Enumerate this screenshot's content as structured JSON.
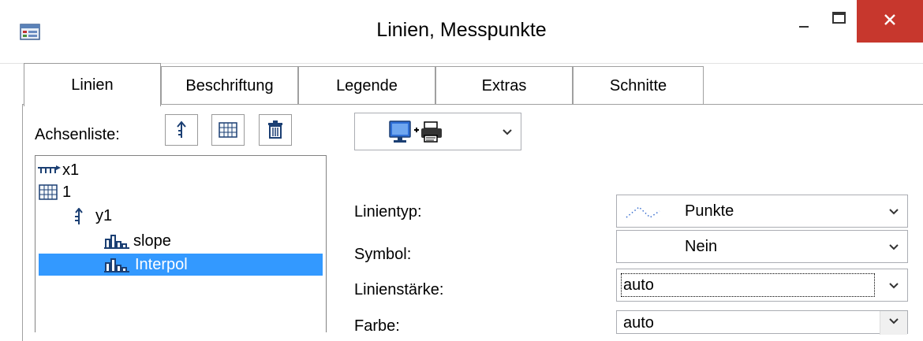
{
  "window": {
    "title": "Linien, Messpunkte",
    "close_symbol": "✕"
  },
  "tabs": [
    {
      "label": "Linien",
      "active": true
    },
    {
      "label": "Beschriftung",
      "active": false
    },
    {
      "label": "Legende",
      "active": false
    },
    {
      "label": "Extras",
      "active": false
    },
    {
      "label": "Schnitte",
      "active": false
    }
  ],
  "axis_list": {
    "label": "Achsenliste:",
    "toolbar": [
      "axis-arrow-icon",
      "grid-icon",
      "trash-icon"
    ]
  },
  "tree": {
    "nodes": [
      {
        "label": "x1",
        "icon": "x-axis-icon"
      },
      {
        "label": "1",
        "icon": "grid-icon"
      },
      {
        "label": "y1",
        "icon": "y-axis-icon"
      },
      {
        "label": "slope",
        "icon": "bar-chart-icon"
      },
      {
        "label": "Interpol",
        "icon": "bar-chart-icon",
        "selected": true
      }
    ]
  },
  "output_select": {
    "icon": "screen-printer-icon"
  },
  "properties": {
    "linetype": {
      "label": "Linientyp:",
      "value": "Punkte"
    },
    "symbol": {
      "label": "Symbol:",
      "value": "Nein"
    },
    "linewidth": {
      "label": "Linienstärke:",
      "value": "auto"
    },
    "color": {
      "label": "Farbe:",
      "value": "auto"
    }
  },
  "colors": {
    "selection": "#3399ff",
    "close_button": "#c7372d"
  }
}
